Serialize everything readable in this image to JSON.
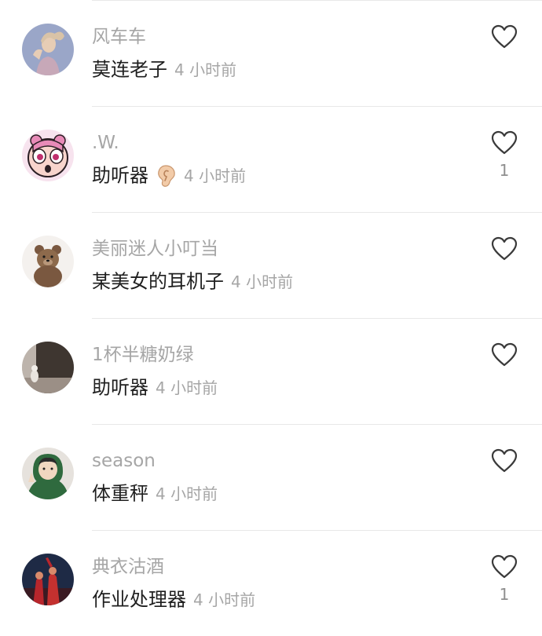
{
  "comments": [
    {
      "username": "风车车",
      "text": "莫连老子",
      "emoji": "",
      "timestamp": "4 小时前",
      "likes": "",
      "avatar": "avatar-woman-ponytail",
      "colors": {
        "bg": "#9aa6c8",
        "accent": "#d9c3a7"
      }
    },
    {
      "username": ".W.",
      "text": "助听器",
      "emoji": "ear-emoji",
      "timestamp": "4 小时前",
      "likes": "1",
      "avatar": "avatar-powerpuff-cartoon",
      "colors": {
        "bg": "#f7e3ee",
        "accent": "#e88bb8"
      }
    },
    {
      "username": "美丽迷人小叮当",
      "text": "某美女的耳机子",
      "emoji": "",
      "timestamp": "4 小时前",
      "likes": "",
      "avatar": "avatar-teddy-bear",
      "colors": {
        "bg": "#f4f1ee",
        "accent": "#7a5840"
      }
    },
    {
      "username": "1杯半糖奶绿",
      "text": "助听器",
      "emoji": "",
      "timestamp": "4 小时前",
      "likes": "",
      "avatar": "avatar-cat-doorway",
      "colors": {
        "bg": "#d1cbc6",
        "accent": "#3e3630"
      }
    },
    {
      "username": "season",
      "text": "体重秤",
      "emoji": "",
      "timestamp": "4 小时前",
      "likes": "",
      "avatar": "avatar-boy-green-hoodie",
      "colors": {
        "bg": "#e6e2dd",
        "accent": "#2f6a3e"
      }
    },
    {
      "username": "典衣沽酒",
      "text": "作业处理器",
      "emoji": "",
      "timestamp": "4 小时前",
      "likes": "1",
      "avatar": "avatar-dark-red-figures",
      "colors": {
        "bg": "#1e2a45",
        "accent": "#b8262c"
      }
    }
  ],
  "icons": {
    "like": "heart-outline-icon",
    "ear": "ear-emoji"
  },
  "theme": {
    "background": "#ffffff",
    "username_color": "#a6a6a6",
    "text_color": "#1f1f1f",
    "divider_color": "#e8e8e8"
  }
}
